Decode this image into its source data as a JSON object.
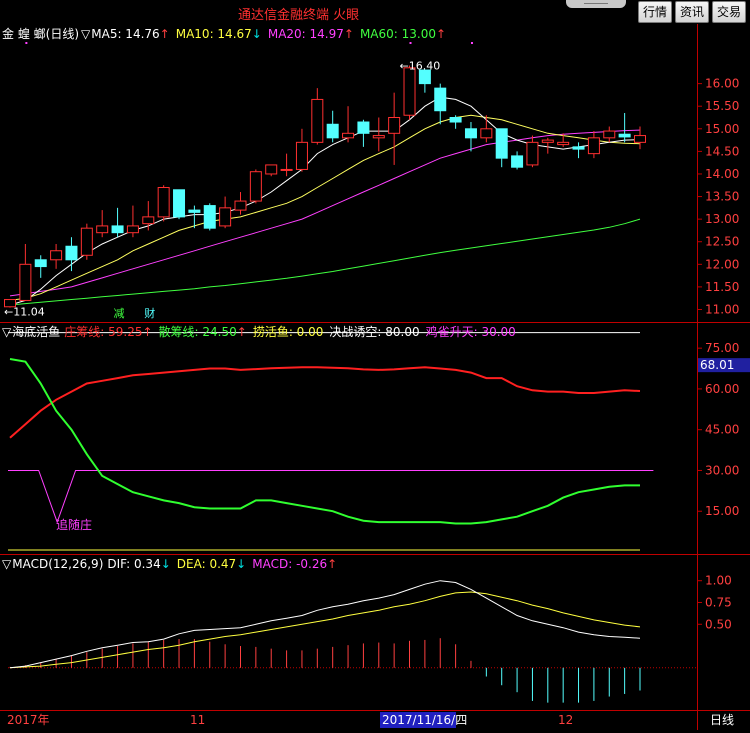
{
  "app": {
    "title": "通达信金融终端  火眼"
  },
  "toolbar": {
    "buttons": [
      "行情",
      "资讯",
      "交易"
    ]
  },
  "stock": {
    "name": "金 蝗 螂",
    "period": "(日线)"
  },
  "main_panel": {
    "indicators": [
      {
        "label": "MA5: 14.76",
        "arrow": "↑",
        "color": "#ffffff",
        "arrow_color": "#ff4040"
      },
      {
        "label": "MA10: 14.67",
        "arrow": "↓",
        "color": "#ffff40",
        "arrow_color": "#00e0e0"
      },
      {
        "label": "MA20: 14.97",
        "arrow": "↑",
        "color": "#ff40ff",
        "arrow_color": "#ff4040"
      },
      {
        "label": "MA60: 13.00",
        "arrow": "↑",
        "color": "#40ff40",
        "arrow_color": "#ff4040"
      }
    ],
    "price_axis": [
      "16.00",
      "15.50",
      "15.00",
      "14.50",
      "14.00",
      "13.50",
      "13.00",
      "12.50",
      "12.00",
      "11.50",
      "11.00"
    ],
    "high_label": "16.40",
    "low_label": "11.04",
    "event_markers": [
      "减",
      "财"
    ]
  },
  "fish_panel": {
    "name": "海底活鱼",
    "indicators": [
      {
        "label": "庄筹线: 59.25",
        "arrow": "↑",
        "color": "#ff3030",
        "arrow_color": "#ff4040"
      },
      {
        "label": "散筹线: 24.50",
        "arrow": "↑",
        "color": "#40ff40",
        "arrow_color": "#ff4040"
      },
      {
        "label": "捞活鱼: 0.00",
        "arrow": "",
        "color": "#ffff40",
        "arrow_color": ""
      },
      {
        "label": "决战诱空: 80.00",
        "arrow": "",
        "color": "#ffffff",
        "arrow_color": ""
      },
      {
        "label": "鸡雀升天: 30.00",
        "arrow": "",
        "color": "#ff40ff",
        "arrow_color": ""
      }
    ],
    "axis": [
      "75.00",
      "60.00",
      "45.00",
      "30.00",
      "15.00"
    ],
    "current_value": "68.01",
    "annotation": "追随庄"
  },
  "macd_panel": {
    "name": "MACD(12,26,9)",
    "indicators": [
      {
        "label": "DIF: 0.34",
        "arrow": "↓",
        "color": "#ffffff",
        "arrow_color": "#00e0e0"
      },
      {
        "label": "DEA: 0.47",
        "arrow": "↓",
        "color": "#ffff40",
        "arrow_color": "#00e0e0"
      },
      {
        "label": "MACD: -0.26",
        "arrow": "↑",
        "color": "#ff40ff",
        "arrow_color": "#ff4040"
      }
    ],
    "axis": [
      "1.00",
      "0.75",
      "0.50"
    ]
  },
  "date_axis": {
    "labels": [
      "2017年",
      "11",
      "12"
    ],
    "cursor_date": "2017/11/16/四",
    "period_label": "日线"
  },
  "chart_data": {
    "type": "candlestick",
    "candles": [
      [
        11.06,
        11.22,
        11.15,
        11.04
      ],
      [
        11.2,
        12.0,
        12.45,
        11.2
      ],
      [
        12.1,
        11.95,
        12.2,
        11.7
      ],
      [
        12.1,
        12.3,
        12.45,
        11.9
      ],
      [
        12.4,
        12.1,
        12.6,
        11.85
      ],
      [
        12.2,
        12.8,
        12.9,
        12.1
      ],
      [
        12.7,
        12.85,
        13.2,
        12.6
      ],
      [
        12.85,
        12.7,
        13.25,
        12.6
      ],
      [
        12.7,
        12.85,
        13.3,
        12.6
      ],
      [
        12.9,
        13.05,
        13.4,
        12.75
      ],
      [
        13.05,
        13.7,
        13.75,
        12.95
      ],
      [
        13.65,
        13.05,
        13.65,
        13.0
      ],
      [
        13.2,
        13.15,
        13.3,
        12.8
      ],
      [
        13.3,
        12.8,
        13.35,
        12.75
      ],
      [
        12.85,
        13.25,
        13.5,
        12.8
      ],
      [
        13.2,
        13.4,
        13.6,
        13.1
      ],
      [
        13.4,
        14.05,
        14.1,
        13.35
      ],
      [
        14.0,
        14.2,
        14.2,
        13.95
      ],
      [
        14.1,
        14.1,
        14.45,
        13.95
      ],
      [
        14.1,
        14.7,
        15.0,
        14.05
      ],
      [
        14.7,
        15.65,
        15.9,
        14.65
      ],
      [
        15.1,
        14.8,
        15.4,
        14.7
      ],
      [
        14.8,
        14.9,
        15.5,
        14.7
      ],
      [
        15.15,
        14.9,
        15.2,
        14.6
      ],
      [
        14.8,
        14.85,
        15.25,
        14.5
      ],
      [
        14.9,
        15.25,
        15.8,
        14.2
      ],
      [
        15.3,
        16.35,
        16.4,
        15.2
      ],
      [
        16.3,
        16.0,
        16.3,
        15.8
      ],
      [
        15.9,
        15.4,
        16.0,
        15.1
      ],
      [
        15.25,
        15.15,
        15.3,
        15.0
      ],
      [
        15.0,
        14.8,
        15.15,
        14.5
      ],
      [
        14.8,
        15.0,
        15.3,
        14.7
      ],
      [
        15.0,
        14.35,
        15.0,
        14.15
      ],
      [
        14.4,
        14.15,
        14.5,
        14.1
      ],
      [
        14.2,
        14.7,
        14.85,
        14.15
      ],
      [
        14.7,
        14.75,
        14.8,
        14.45
      ],
      [
        14.65,
        14.7,
        14.9,
        14.6
      ],
      [
        14.6,
        14.55,
        14.7,
        14.35
      ],
      [
        14.45,
        14.8,
        14.95,
        14.35
      ],
      [
        14.8,
        14.95,
        15.05,
        14.7
      ],
      [
        14.88,
        14.82,
        15.35,
        14.7
      ],
      [
        14.7,
        14.85,
        15.05,
        14.55
      ]
    ],
    "ma5": [
      11.1,
      11.2,
      11.45,
      11.75,
      12.0,
      12.25,
      12.45,
      12.6,
      12.75,
      12.85,
      13.0,
      13.05,
      13.1,
      13.1,
      13.15,
      13.25,
      13.4,
      13.6,
      13.85,
      14.1,
      14.45,
      14.65,
      14.8,
      14.95,
      14.95,
      14.95,
      15.2,
      15.5,
      15.7,
      15.65,
      15.5,
      15.2,
      14.9,
      14.75,
      14.65,
      14.6,
      14.55,
      14.6,
      14.65,
      14.7,
      14.75,
      14.76
    ],
    "ma10": [
      11.2,
      11.25,
      11.35,
      11.5,
      11.65,
      11.8,
      11.95,
      12.1,
      12.3,
      12.45,
      12.6,
      12.75,
      12.85,
      12.95,
      13.0,
      13.05,
      13.15,
      13.25,
      13.35,
      13.5,
      13.7,
      13.9,
      14.1,
      14.3,
      14.45,
      14.6,
      14.8,
      15.0,
      15.15,
      15.25,
      15.3,
      15.25,
      15.2,
      15.1,
      15.0,
      14.9,
      14.85,
      14.8,
      14.75,
      14.7,
      14.68,
      14.67
    ],
    "ma20": [
      11.3,
      11.35,
      11.4,
      11.45,
      11.5,
      11.6,
      11.7,
      11.8,
      11.9,
      12.0,
      12.1,
      12.2,
      12.3,
      12.4,
      12.5,
      12.6,
      12.7,
      12.8,
      12.9,
      13.0,
      13.15,
      13.3,
      13.45,
      13.6,
      13.75,
      13.9,
      14.05,
      14.2,
      14.35,
      14.45,
      14.55,
      14.65,
      14.7,
      14.75,
      14.8,
      14.85,
      14.88,
      14.9,
      14.92,
      14.94,
      14.96,
      14.97
    ],
    "ma60": [
      11.1,
      11.13,
      11.16,
      11.19,
      11.22,
      11.25,
      11.28,
      11.31,
      11.34,
      11.37,
      11.4,
      11.43,
      11.46,
      11.5,
      11.53,
      11.57,
      11.61,
      11.65,
      11.69,
      11.74,
      11.79,
      11.84,
      11.9,
      11.96,
      12.02,
      12.08,
      12.14,
      12.2,
      12.26,
      12.31,
      12.36,
      12.41,
      12.46,
      12.51,
      12.56,
      12.61,
      12.66,
      12.71,
      12.76,
      12.82,
      12.9,
      13.0
    ],
    "zhuang": [
      42,
      47,
      52,
      56,
      59,
      62,
      63,
      64,
      65,
      65.5,
      66,
      66.5,
      67,
      67.5,
      67.5,
      67,
      67.3,
      67.6,
      67.8,
      68,
      68,
      67.8,
      67.6,
      67.2,
      67,
      67.2,
      67.6,
      68,
      67.5,
      67,
      66,
      64,
      64,
      61,
      59.5,
      59,
      59,
      58.5,
      58.5,
      59,
      59.5,
      59.25
    ],
    "san": [
      71,
      70,
      62,
      52,
      45,
      36,
      28,
      25,
      22,
      20.5,
      19,
      18,
      16.5,
      16,
      16,
      16,
      19,
      19,
      18,
      17,
      16,
      15,
      13,
      11.5,
      11,
      11,
      11,
      11,
      11,
      10.5,
      10.5,
      11,
      12,
      13,
      15,
      17,
      20,
      22,
      23,
      24,
      24.5,
      24.5
    ],
    "follow_line": [
      [
        0,
        30
      ],
      [
        2,
        30
      ],
      [
        3.2,
        11
      ],
      [
        4.4,
        30
      ],
      [
        42,
        30
      ]
    ],
    "macd_dif": [
      0.0,
      0.02,
      0.06,
      0.1,
      0.14,
      0.19,
      0.23,
      0.26,
      0.29,
      0.3,
      0.33,
      0.39,
      0.43,
      0.44,
      0.45,
      0.46,
      0.5,
      0.54,
      0.57,
      0.6,
      0.66,
      0.7,
      0.73,
      0.77,
      0.8,
      0.84,
      0.9,
      0.96,
      1.0,
      0.98,
      0.9,
      0.8,
      0.7,
      0.6,
      0.54,
      0.5,
      0.46,
      0.41,
      0.38,
      0.36,
      0.35,
      0.34
    ],
    "macd_dea": [
      0.0,
      0.01,
      0.02,
      0.04,
      0.06,
      0.09,
      0.12,
      0.15,
      0.18,
      0.21,
      0.23,
      0.26,
      0.3,
      0.33,
      0.36,
      0.38,
      0.41,
      0.44,
      0.47,
      0.5,
      0.53,
      0.56,
      0.6,
      0.63,
      0.66,
      0.7,
      0.73,
      0.77,
      0.82,
      0.86,
      0.87,
      0.85,
      0.81,
      0.77,
      0.72,
      0.68,
      0.63,
      0.59,
      0.55,
      0.52,
      0.49,
      0.47
    ],
    "macd_hist": [
      0.01,
      0.03,
      0.06,
      0.1,
      0.14,
      0.18,
      0.22,
      0.25,
      0.28,
      0.3,
      0.32,
      0.33,
      0.33,
      0.3,
      0.27,
      0.25,
      0.24,
      0.22,
      0.2,
      0.2,
      0.22,
      0.24,
      0.26,
      0.28,
      0.29,
      0.28,
      0.31,
      0.32,
      0.34,
      0.27,
      0.08,
      -0.1,
      -0.2,
      -0.28,
      -0.38,
      -0.4,
      -0.4,
      -0.4,
      -0.38,
      -0.33,
      -0.3,
      -0.26
    ],
    "price_range": [
      10.9,
      16.7
    ],
    "fish_range": [
      0,
      78
    ],
    "macd_range": [
      -0.45,
      1.1
    ]
  }
}
